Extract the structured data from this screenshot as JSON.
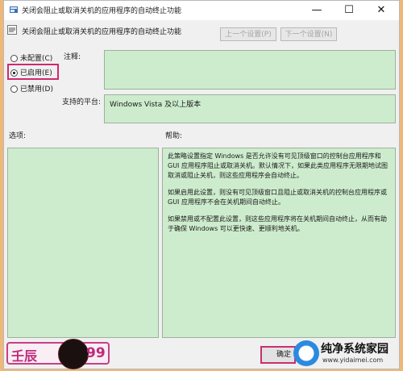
{
  "window": {
    "title": "关闭会阻止或取消关机的应用程序的自动终止功能",
    "minimize": "—",
    "maximize": "☐",
    "close": "✕"
  },
  "header": {
    "policy_name": "关闭会阻止或取消关机的应用程序的自动终止功能",
    "prev_button": "上一个设置(P)",
    "next_button": "下一个设置(N)"
  },
  "options": [
    {
      "label": "未配置(C)",
      "selected": false
    },
    {
      "label": "已启用(E)",
      "selected": true
    },
    {
      "label": "已禁用(D)",
      "selected": false
    }
  ],
  "comment": {
    "label": "注释:",
    "value": ""
  },
  "platform": {
    "label": "支持的平台:",
    "value": "Windows Vista 及以上版本"
  },
  "sections": {
    "options_label": "选项:",
    "help_label": "帮助:"
  },
  "help": [
    "此策略设置指定 Windows 是否允许没有可见顶级窗口的控制台应用程序和 GUI 应用程序阻止或取消关机。默认情况下，如果此类应用程序无限期地试图取消或阻止关机，则这些应用程序会自动终止。",
    "如果启用此设置，则没有可见顶级窗口且阻止或取消关机的控制台应用程序或 GUI 应用程序不会在关机期间自动终止。",
    "如果禁用或不配置此设置，则这些应用程序将在关机期间自动终止，从而有助于确保 Windows 可以更快速、更顺利地关机。"
  ],
  "footer": {
    "ok_button": "确定"
  },
  "watermark_logo": {
    "left_text": "壬辰",
    "right_text": "99"
  },
  "watermark_site": {
    "title": "纯净系统家园",
    "url": "www.yidaimei.com"
  },
  "colors": {
    "green_panel": "#cdeccd",
    "highlight": "#cf2a6f",
    "background": "#efb877"
  }
}
